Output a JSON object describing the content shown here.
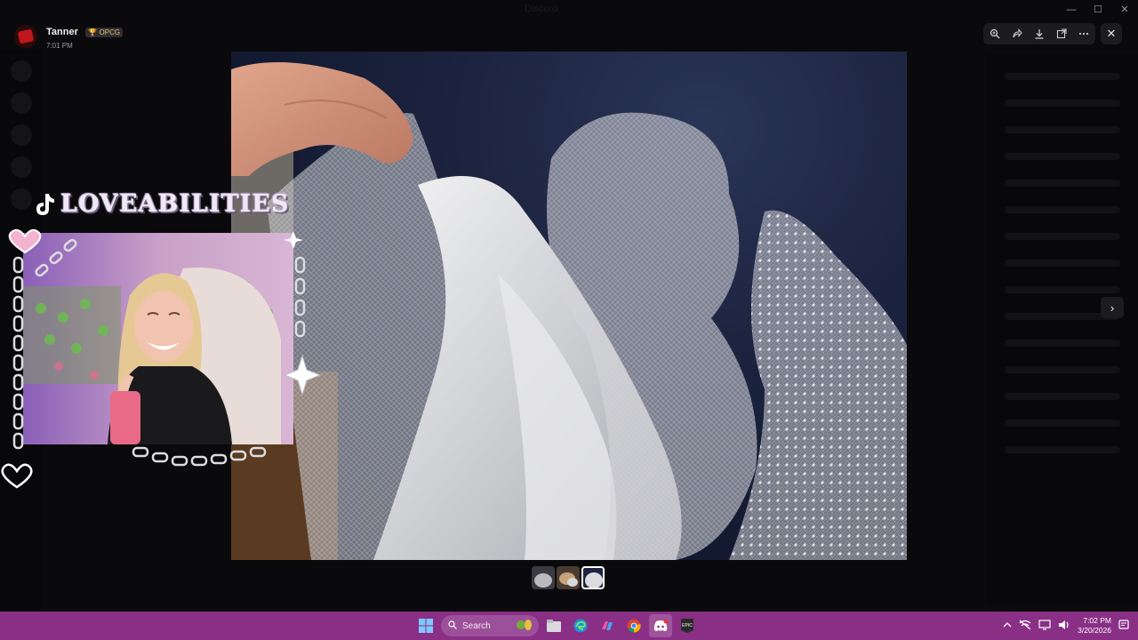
{
  "window": {
    "title": "Discord"
  },
  "author": {
    "name": "Tanner",
    "badge": "OPCG",
    "time": "7:01 PM"
  },
  "toolbar": {
    "icons": [
      "zoom-icon",
      "forward-icon",
      "download-icon",
      "open-external-icon",
      "more-icon"
    ],
    "close_glyph": "✕"
  },
  "viewer": {
    "next_glyph": "›"
  },
  "thumbnails": {
    "count": 3,
    "active_index": 2
  },
  "overlay": {
    "streamer_name": "LOVEABILITIES"
  },
  "taskbar": {
    "search_label": "Search",
    "time": "7:02 PM",
    "date": "3/20/2026",
    "accent": "#8a2f86"
  }
}
